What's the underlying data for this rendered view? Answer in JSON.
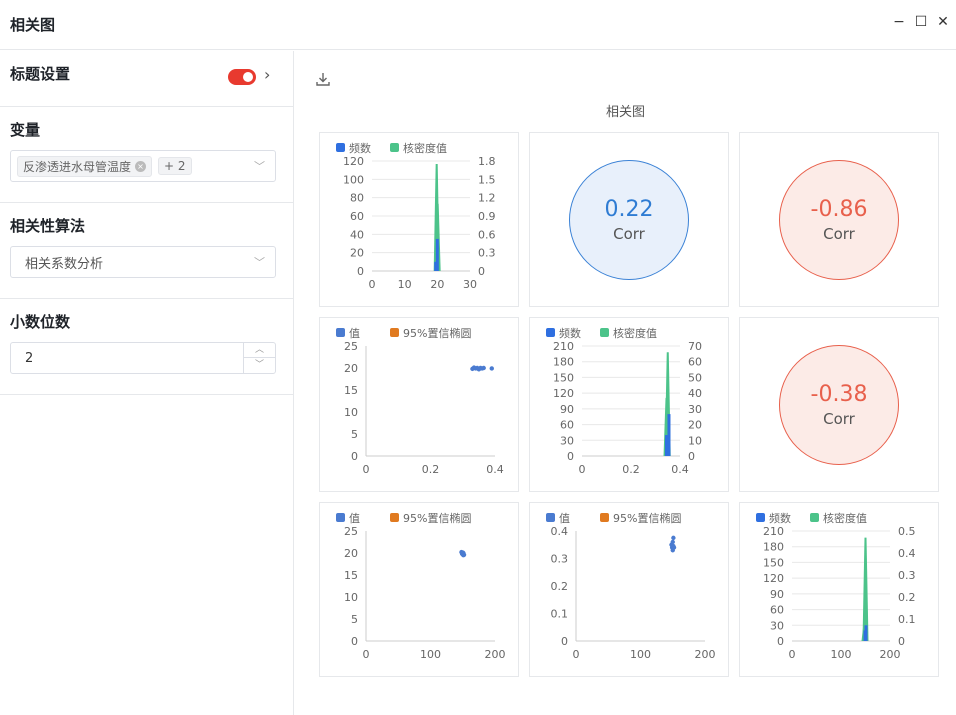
{
  "window": {
    "title": "相关图",
    "minimize": "−",
    "maximize": "☐",
    "close": "✕"
  },
  "sidebar": {
    "title_settings": {
      "label": "标题设置",
      "toggle_on": true,
      "chevron": "›"
    },
    "variables": {
      "label": "变量",
      "tag": "反渗透进水母管温度",
      "more": "+ 2"
    },
    "algorithm": {
      "label": "相关性算法",
      "value": "相关系数分析"
    },
    "decimals": {
      "label": "小数位数",
      "value": "2"
    }
  },
  "main": {
    "download_icon": "download-icon",
    "chart_title": "相关图"
  },
  "colors": {
    "freq": "#2f6fe0",
    "kde": "#4cc38a",
    "scatter": "#4a7bd0",
    "ellipse": "#e07a20",
    "pos": "#2f7cd3",
    "neg": "#e8604c"
  },
  "legend": {
    "freq": "频数",
    "kde": "核密度值",
    "value": "值",
    "ellipse": "95%置信椭圆"
  },
  "corr": [
    {
      "value": "0.22",
      "label": "Corr"
    },
    {
      "value": "-0.86",
      "label": "Corr"
    },
    {
      "value": "-0.38",
      "label": "Corr"
    }
  ],
  "chart_data": [
    {
      "type": "histogram",
      "cell": "1-1",
      "xticks": [
        "0",
        "10",
        "20",
        "30"
      ],
      "xlim": [
        0,
        30
      ],
      "yticks_left": [
        "0",
        "20",
        "40",
        "60",
        "80",
        "100",
        "120"
      ],
      "ylim_left": [
        0,
        120
      ],
      "yticks_right": [
        "0",
        "0.3",
        "0.6",
        "0.9",
        "1.2",
        "1.5",
        "1.8"
      ],
      "ylim_right": [
        0,
        1.8
      ],
      "legend": [
        "频数",
        "核密度值"
      ],
      "freq_bars": [
        {
          "x": 19.5,
          "y": 10
        },
        {
          "x": 20,
          "y": 35
        }
      ],
      "kde_peaks": [
        {
          "x": 19.8,
          "y": 1.75
        },
        {
          "x": 20.1,
          "y": 1.1
        }
      ]
    },
    {
      "type": "scatter",
      "cell": "2-1",
      "xticks": [
        "0",
        "0.2",
        "0.4"
      ],
      "xlim": [
        0,
        0.4
      ],
      "yticks": [
        "0",
        "5",
        "10",
        "15",
        "20",
        "25"
      ],
      "ylim": [
        0,
        25
      ],
      "legend": [
        "值",
        "95%置信椭圆"
      ],
      "points": [
        [
          0.33,
          19.8
        ],
        [
          0.335,
          20.1
        ],
        [
          0.34,
          19.9
        ],
        [
          0.345,
          20.0
        ],
        [
          0.35,
          19.7
        ],
        [
          0.355,
          20.0
        ],
        [
          0.36,
          19.9
        ],
        [
          0.365,
          20.0
        ],
        [
          0.39,
          19.9
        ]
      ]
    },
    {
      "type": "histogram",
      "cell": "2-2",
      "xticks": [
        "0",
        "0.2",
        "0.4"
      ],
      "xlim": [
        0,
        0.4
      ],
      "yticks_left": [
        "0",
        "30",
        "60",
        "90",
        "120",
        "150",
        "180",
        "210"
      ],
      "ylim_left": [
        0,
        210
      ],
      "yticks_right": [
        "0",
        "10",
        "20",
        "30",
        "40",
        "50",
        "60",
        "70"
      ],
      "ylim_right": [
        0,
        70
      ],
      "legend": [
        "频数",
        "核密度值"
      ],
      "freq_bars": [
        {
          "x": 0.345,
          "y": 40
        },
        {
          "x": 0.355,
          "y": 80
        }
      ],
      "kde_peaks": [
        {
          "x": 0.35,
          "y": 66
        },
        {
          "x": 0.345,
          "y": 37
        }
      ]
    },
    {
      "type": "scatter",
      "cell": "3-1",
      "xticks": [
        "0",
        "100",
        "200"
      ],
      "xlim": [
        0,
        200
      ],
      "yticks": [
        "0",
        "5",
        "10",
        "15",
        "20",
        "25"
      ],
      "ylim": [
        0,
        25
      ],
      "legend": [
        "值",
        "95%置信椭圆"
      ],
      "points": [
        [
          148,
          20.2
        ],
        [
          149,
          19.9
        ],
        [
          150,
          19.7
        ],
        [
          151,
          20.0
        ],
        [
          152,
          19.6
        ],
        [
          150,
          20.1
        ],
        [
          149,
          19.8
        ],
        [
          151,
          19.5
        ]
      ]
    },
    {
      "type": "scatter",
      "cell": "3-2",
      "xticks": [
        "0",
        "100",
        "200"
      ],
      "xlim": [
        0,
        200
      ],
      "yticks": [
        "0",
        "0.1",
        "0.2",
        "0.3",
        "0.4"
      ],
      "ylim": [
        0,
        0.4
      ],
      "legend": [
        "值",
        "95%置信椭圆"
      ],
      "points": [
        [
          148,
          0.35
        ],
        [
          149,
          0.34
        ],
        [
          150,
          0.33
        ],
        [
          151,
          0.345
        ],
        [
          150,
          0.36
        ],
        [
          152,
          0.34
        ],
        [
          151,
          0.375
        ]
      ]
    },
    {
      "type": "histogram",
      "cell": "3-3",
      "xticks": [
        "0",
        "100",
        "200"
      ],
      "xlim": [
        0,
        200
      ],
      "yticks_left": [
        "0",
        "30",
        "60",
        "90",
        "120",
        "150",
        "180",
        "210"
      ],
      "ylim_left": [
        0,
        210
      ],
      "yticks_right": [
        "0",
        "0.1",
        "0.2",
        "0.3",
        "0.4",
        "0.5"
      ],
      "ylim_right": [
        0,
        0.5
      ],
      "legend": [
        "频数",
        "核密度值"
      ],
      "freq_bars": [
        {
          "x": 149,
          "y": 20
        },
        {
          "x": 151,
          "y": 30
        }
      ],
      "kde_peaks": [
        {
          "x": 150,
          "y": 0.47
        },
        {
          "x": 148,
          "y": 0.08
        }
      ]
    }
  ]
}
